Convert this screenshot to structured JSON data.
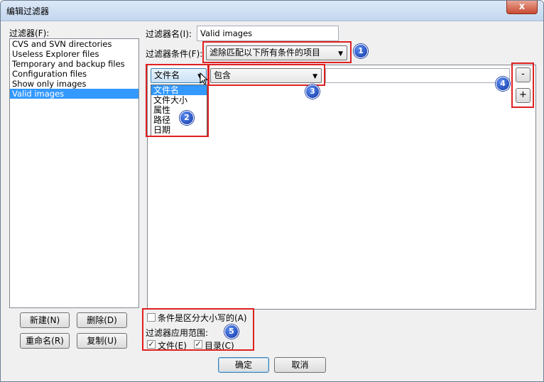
{
  "window": {
    "title": "编辑过滤器",
    "close_glyph": "x"
  },
  "filters": {
    "label": "过滤器(F):",
    "items": [
      "CVS and SVN directories",
      "Useless Explorer files",
      "Temporary and backup files",
      "Configuration files",
      "Show only images",
      "Valid images"
    ],
    "selected_index": 5
  },
  "filter_name": {
    "label": "过滤器名(I):",
    "value": "Valid images"
  },
  "filter_condition": {
    "label": "过滤器条件(F):",
    "value": "滤除匹配以下所有条件的项目"
  },
  "rule": {
    "field": "文件名",
    "field_options": [
      "文件名",
      "文件大小",
      "属性",
      "路径",
      "日期"
    ],
    "highlighted_option": 0,
    "operator": "包含",
    "value": ""
  },
  "rule_buttons": {
    "remove": "-",
    "add": "+"
  },
  "options": {
    "case_sensitive": {
      "label": "条件是区分大小写的(A)",
      "checked": false
    },
    "scope_label": "过滤器应用范围:",
    "files": {
      "label": "文件(E)",
      "checked": true
    },
    "dirs": {
      "label": "目录(C)",
      "checked": true
    },
    "check_glyph": "✓"
  },
  "left_buttons": {
    "new": "新建(N)",
    "delete": "删除(D)",
    "rename": "重命名(R)",
    "copy": "复制(U)"
  },
  "footer": {
    "ok": "确定",
    "cancel": "取消"
  },
  "annotations": {
    "b1": "1",
    "b2": "2",
    "b3": "3",
    "b4": "4",
    "b5": "5",
    "color": "#e02020"
  }
}
